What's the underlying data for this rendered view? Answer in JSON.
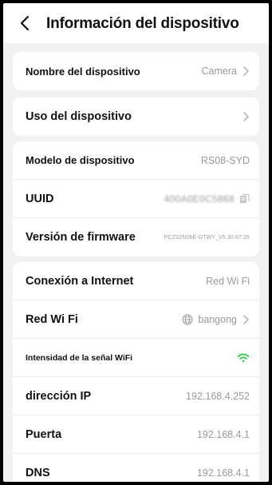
{
  "header": {
    "title": "Información del dispositivo"
  },
  "card1": {
    "device_name_label": "Nombre del dispositivo",
    "device_name_value": "Camera"
  },
  "card2": {
    "device_use_label": "Uso del dispositivo"
  },
  "card3": {
    "model_label": "Modelo de dispositivo",
    "model_value": "RS08-SYD",
    "uuid_label": "UUID",
    "uuid_value": "400A0E0C5868",
    "firmware_label": "Versión de firmware",
    "firmware_value": "PC2S2N06E-GTWY_V5.30.87.05"
  },
  "card4": {
    "internet_label": "Conexión a Internet",
    "internet_value": "Red Wi Fi",
    "wifi_label": "Red Wi Fi",
    "wifi_value": "bangong",
    "signal_label": "Intensidad de la señal WiFi",
    "ip_label": "dirección IP",
    "ip_value": "192.168.4.252",
    "gateway_label": "Puerta",
    "gateway_value": "192.168.4.1",
    "dns_label": "DNS",
    "dns_value": "192.168.4.1"
  },
  "colors": {
    "accent_green": "#2ecc40",
    "muted": "#9a9a9a"
  }
}
